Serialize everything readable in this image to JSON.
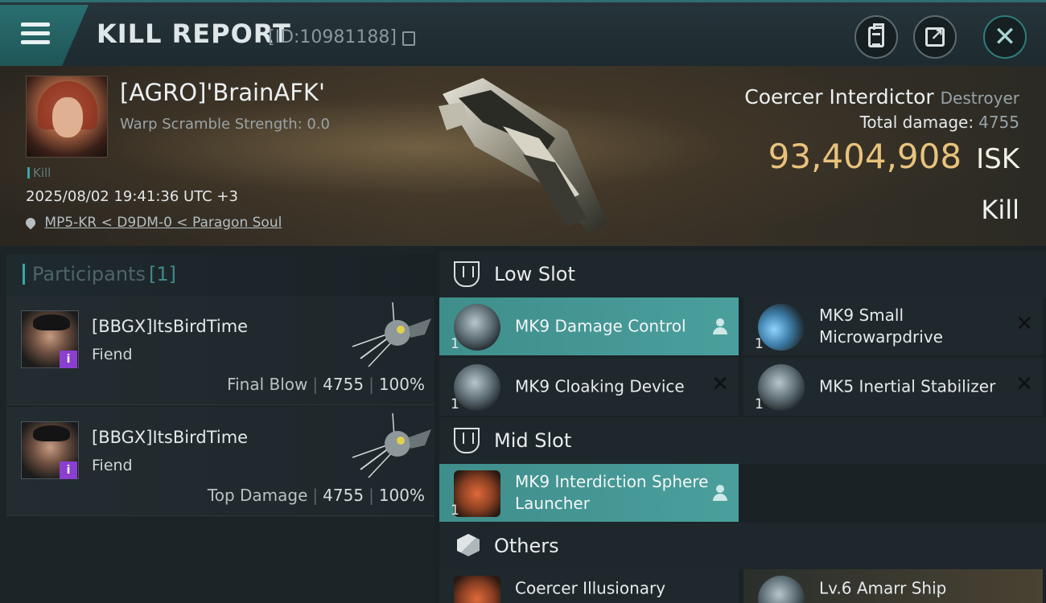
{
  "header": {
    "title": "KILL REPORT",
    "id_text": "[ID:10981188]"
  },
  "banner": {
    "pilot_name": "[AGRO]'BrainAFK'",
    "warp_scramble": "Warp Scramble Strength: 0.0",
    "kill_tag": "Kill",
    "datetime": "2025/08/02 19:41:36 UTC +3",
    "location": "MP5-KR < D9DM-0 < Paragon Soul",
    "ship_name": "Coercer Interdictor",
    "ship_class": "Destroyer",
    "total_damage_label": "Total damage:",
    "total_damage_value": "4755",
    "isk_value": "93,404,908",
    "isk_unit": "ISK",
    "result": "Kill"
  },
  "participants": {
    "label": "Participants",
    "count": "[1]",
    "rows": [
      {
        "name": "[BBGX]ItsBirdTime",
        "ship": "Fiend",
        "role": "Final Blow",
        "damage": "4755",
        "percent": "100%",
        "badge": "i"
      },
      {
        "name": "[BBGX]ItsBirdTime",
        "ship": "Fiend",
        "role": "Top Damage",
        "damage": "4755",
        "percent": "100%",
        "badge": "i"
      }
    ]
  },
  "sections": {
    "low_slot": "Low Slot",
    "mid_slot": "Mid Slot",
    "others": "Others"
  },
  "items": {
    "low": [
      {
        "name": "MK9 Damage Control",
        "qty": "1"
      },
      {
        "name": "MK9 Small Microwarpdrive",
        "qty": "1"
      },
      {
        "name": "MK9 Cloaking Device",
        "qty": "1"
      },
      {
        "name": "MK5 Inertial Stabilizer",
        "qty": "1"
      }
    ],
    "mid": [
      {
        "name": "MK9 Interdiction Sphere Launcher",
        "qty": "1"
      }
    ],
    "others": [
      {
        "name": "Coercer Illusionary"
      },
      {
        "name": "Lv.6 Amarr Ship"
      }
    ]
  },
  "colors": {
    "accent": "#3aa6a6",
    "highlight_row": "#4a9f9c",
    "isk": "#e8c27d",
    "badge": "#8a3fd1"
  },
  "icons": [
    "menu-icon",
    "copy-icon",
    "clipboard-icon",
    "share-icon",
    "close-icon",
    "pin-icon",
    "person-icon",
    "x-icon",
    "slot-icon",
    "box-icon"
  ]
}
